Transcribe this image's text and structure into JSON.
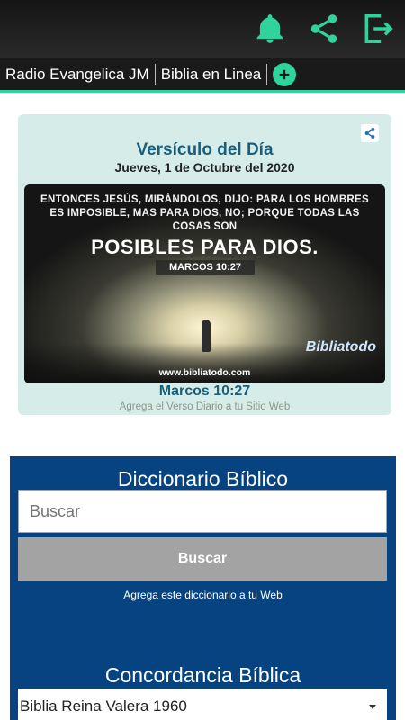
{
  "appbar": {
    "icons": [
      "bell-icon",
      "share-icon",
      "exit-icon"
    ],
    "accent": "#2fd39b"
  },
  "tabs": {
    "items": [
      {
        "label": "Radio Evangelica JM"
      },
      {
        "label": "Biblia en Linea"
      }
    ],
    "add_icon": "plus-circle-icon"
  },
  "verse": {
    "title": "Versículo del Día",
    "date": "Jueves, 1 de Octubre del 2020",
    "image_text_lines": "ENTONCES JESÚS, MIRÁNDOLOS, DIJO: PARA LOS HOMBRES ES IMPOSIBLE, MAS PARA DIOS, NO; PORQUE TODAS LAS COSAS SON",
    "image_big_text": "POSIBLES PARA DIOS.",
    "image_ref": "MARCOS 10:27",
    "image_site": "www.bibliatodo.com",
    "image_logo": "Bibliatodo",
    "reference": "Marcos 10:27",
    "add_link": "Agrega el Verso Diario a tu Sitio Web"
  },
  "dictionary": {
    "title": "Diccionario Bíblico",
    "input_placeholder": "Buscar",
    "button_label": "Buscar",
    "add_link": "Agrega este diccionario a tu Web"
  },
  "concordance": {
    "title": "Concordancia Bíblica",
    "selected_version": "Biblia Reina Valera 1960"
  }
}
